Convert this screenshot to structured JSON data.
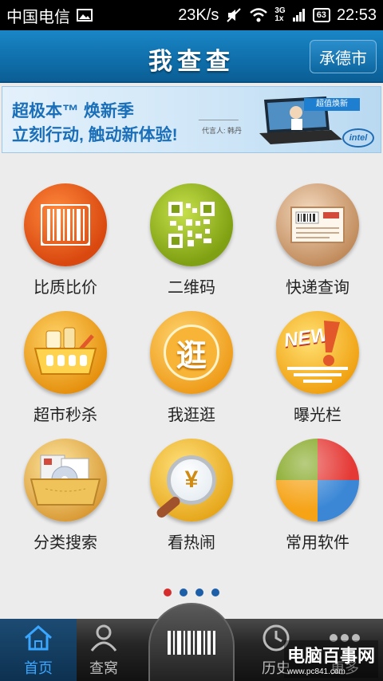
{
  "status": {
    "carrier": "中国电信",
    "speed": "23K/s",
    "network": "3G",
    "network2": "1x",
    "battery": "63",
    "time": "22:53"
  },
  "header": {
    "title": "我查查",
    "city": "承德市"
  },
  "banner": {
    "line1": "超极本™ 焕新季",
    "line2": "立刻行动, 触动新体验!",
    "endorser": "代言人: 韩丹",
    "tag": "超值焕新",
    "brand": "intel"
  },
  "grid": [
    {
      "label": "比质比价",
      "icon": "barcode-icon",
      "color": "#e8561a"
    },
    {
      "label": "二维码",
      "icon": "qr-code-icon",
      "color": "#8fb21c"
    },
    {
      "label": "快递查询",
      "icon": "package-label-icon",
      "color": "#c9a078"
    },
    {
      "label": "超市秒杀",
      "icon": "shopping-basket-icon",
      "color": "#f0a81e"
    },
    {
      "label": "我逛逛",
      "icon": "stroll-badge-icon",
      "badge": "逛",
      "color": "#f4a623"
    },
    {
      "label": "曝光栏",
      "icon": "new-alert-icon",
      "badge": "NEW",
      "color": "#f6b31f"
    },
    {
      "label": "分类搜索",
      "icon": "folder-category-icon",
      "color": "#e8b04a"
    },
    {
      "label": "看热闹",
      "icon": "magnifier-yen-icon",
      "badge": "¥",
      "color": "#f2c12e"
    },
    {
      "label": "常用软件",
      "icon": "pie-apps-icon",
      "color": "#3b87d6"
    }
  ],
  "pager": {
    "count": 4,
    "active": 0
  },
  "nav": {
    "home": "首页",
    "nest": "查窝",
    "history": "历史",
    "more": "更多"
  },
  "watermark": {
    "text": "电脑百事网",
    "sub": "www.pc841.com"
  }
}
